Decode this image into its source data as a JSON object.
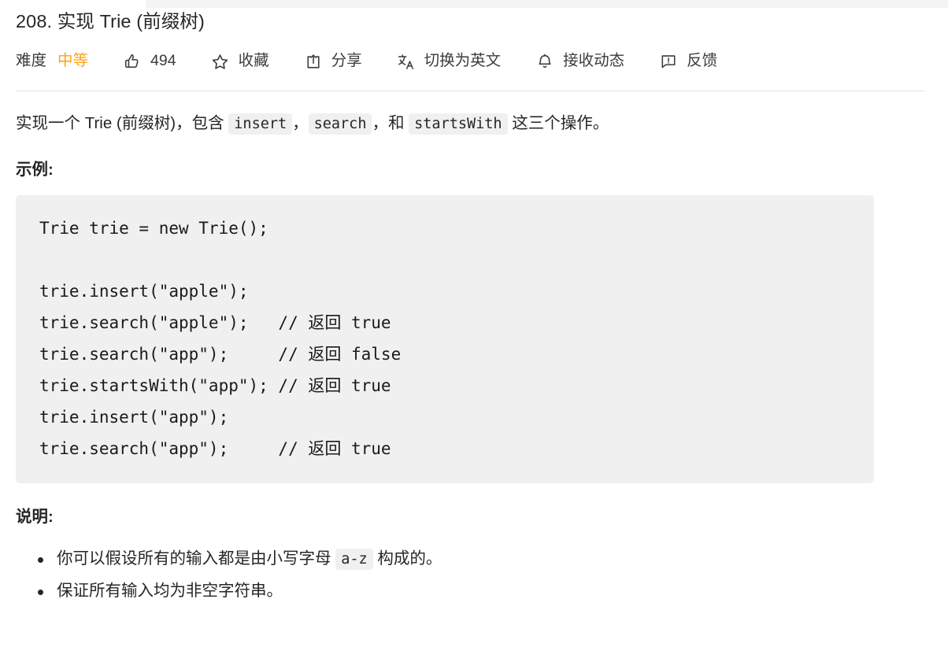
{
  "problem": {
    "title": "208. 实现 Trie (前缀树)"
  },
  "toolbar": {
    "difficulty_label": "难度",
    "difficulty_value": "中等",
    "difficulty_color": "#FFA116",
    "likes_count": "494",
    "favorite_label": "收藏",
    "share_label": "分享",
    "translate_label": "切换为英文",
    "subscribe_label": "接收动态",
    "feedback_label": "反馈",
    "icons": {
      "like": "thumbs-up-icon",
      "favorite": "star-icon",
      "share": "share-icon",
      "translate": "translate-icon",
      "subscribe": "bell-icon",
      "feedback": "feedback-icon"
    }
  },
  "description": {
    "prefix": "实现一个 Trie (前缀树)，包含 ",
    "code1": "insert",
    "sep1": "，",
    "code2": "search",
    "sep2": "，和 ",
    "code3": "startsWith",
    "suffix": " 这三个操作。"
  },
  "example": {
    "heading": "示例:",
    "code": "Trie trie = new Trie();\n\ntrie.insert(\"apple\");\ntrie.search(\"apple\");   // 返回 true\ntrie.search(\"app\");     // 返回 false\ntrie.startsWith(\"app\"); // 返回 true\ntrie.insert(\"app\");\ntrie.search(\"app\");     // 返回 true"
  },
  "notes": {
    "heading": "说明:",
    "items": [
      {
        "prefix": "你可以假设所有的输入都是由小写字母 ",
        "code": "a-z",
        "suffix": " 构成的。"
      },
      {
        "prefix": "保证所有输入均为非空字符串。",
        "code": "",
        "suffix": ""
      }
    ]
  }
}
